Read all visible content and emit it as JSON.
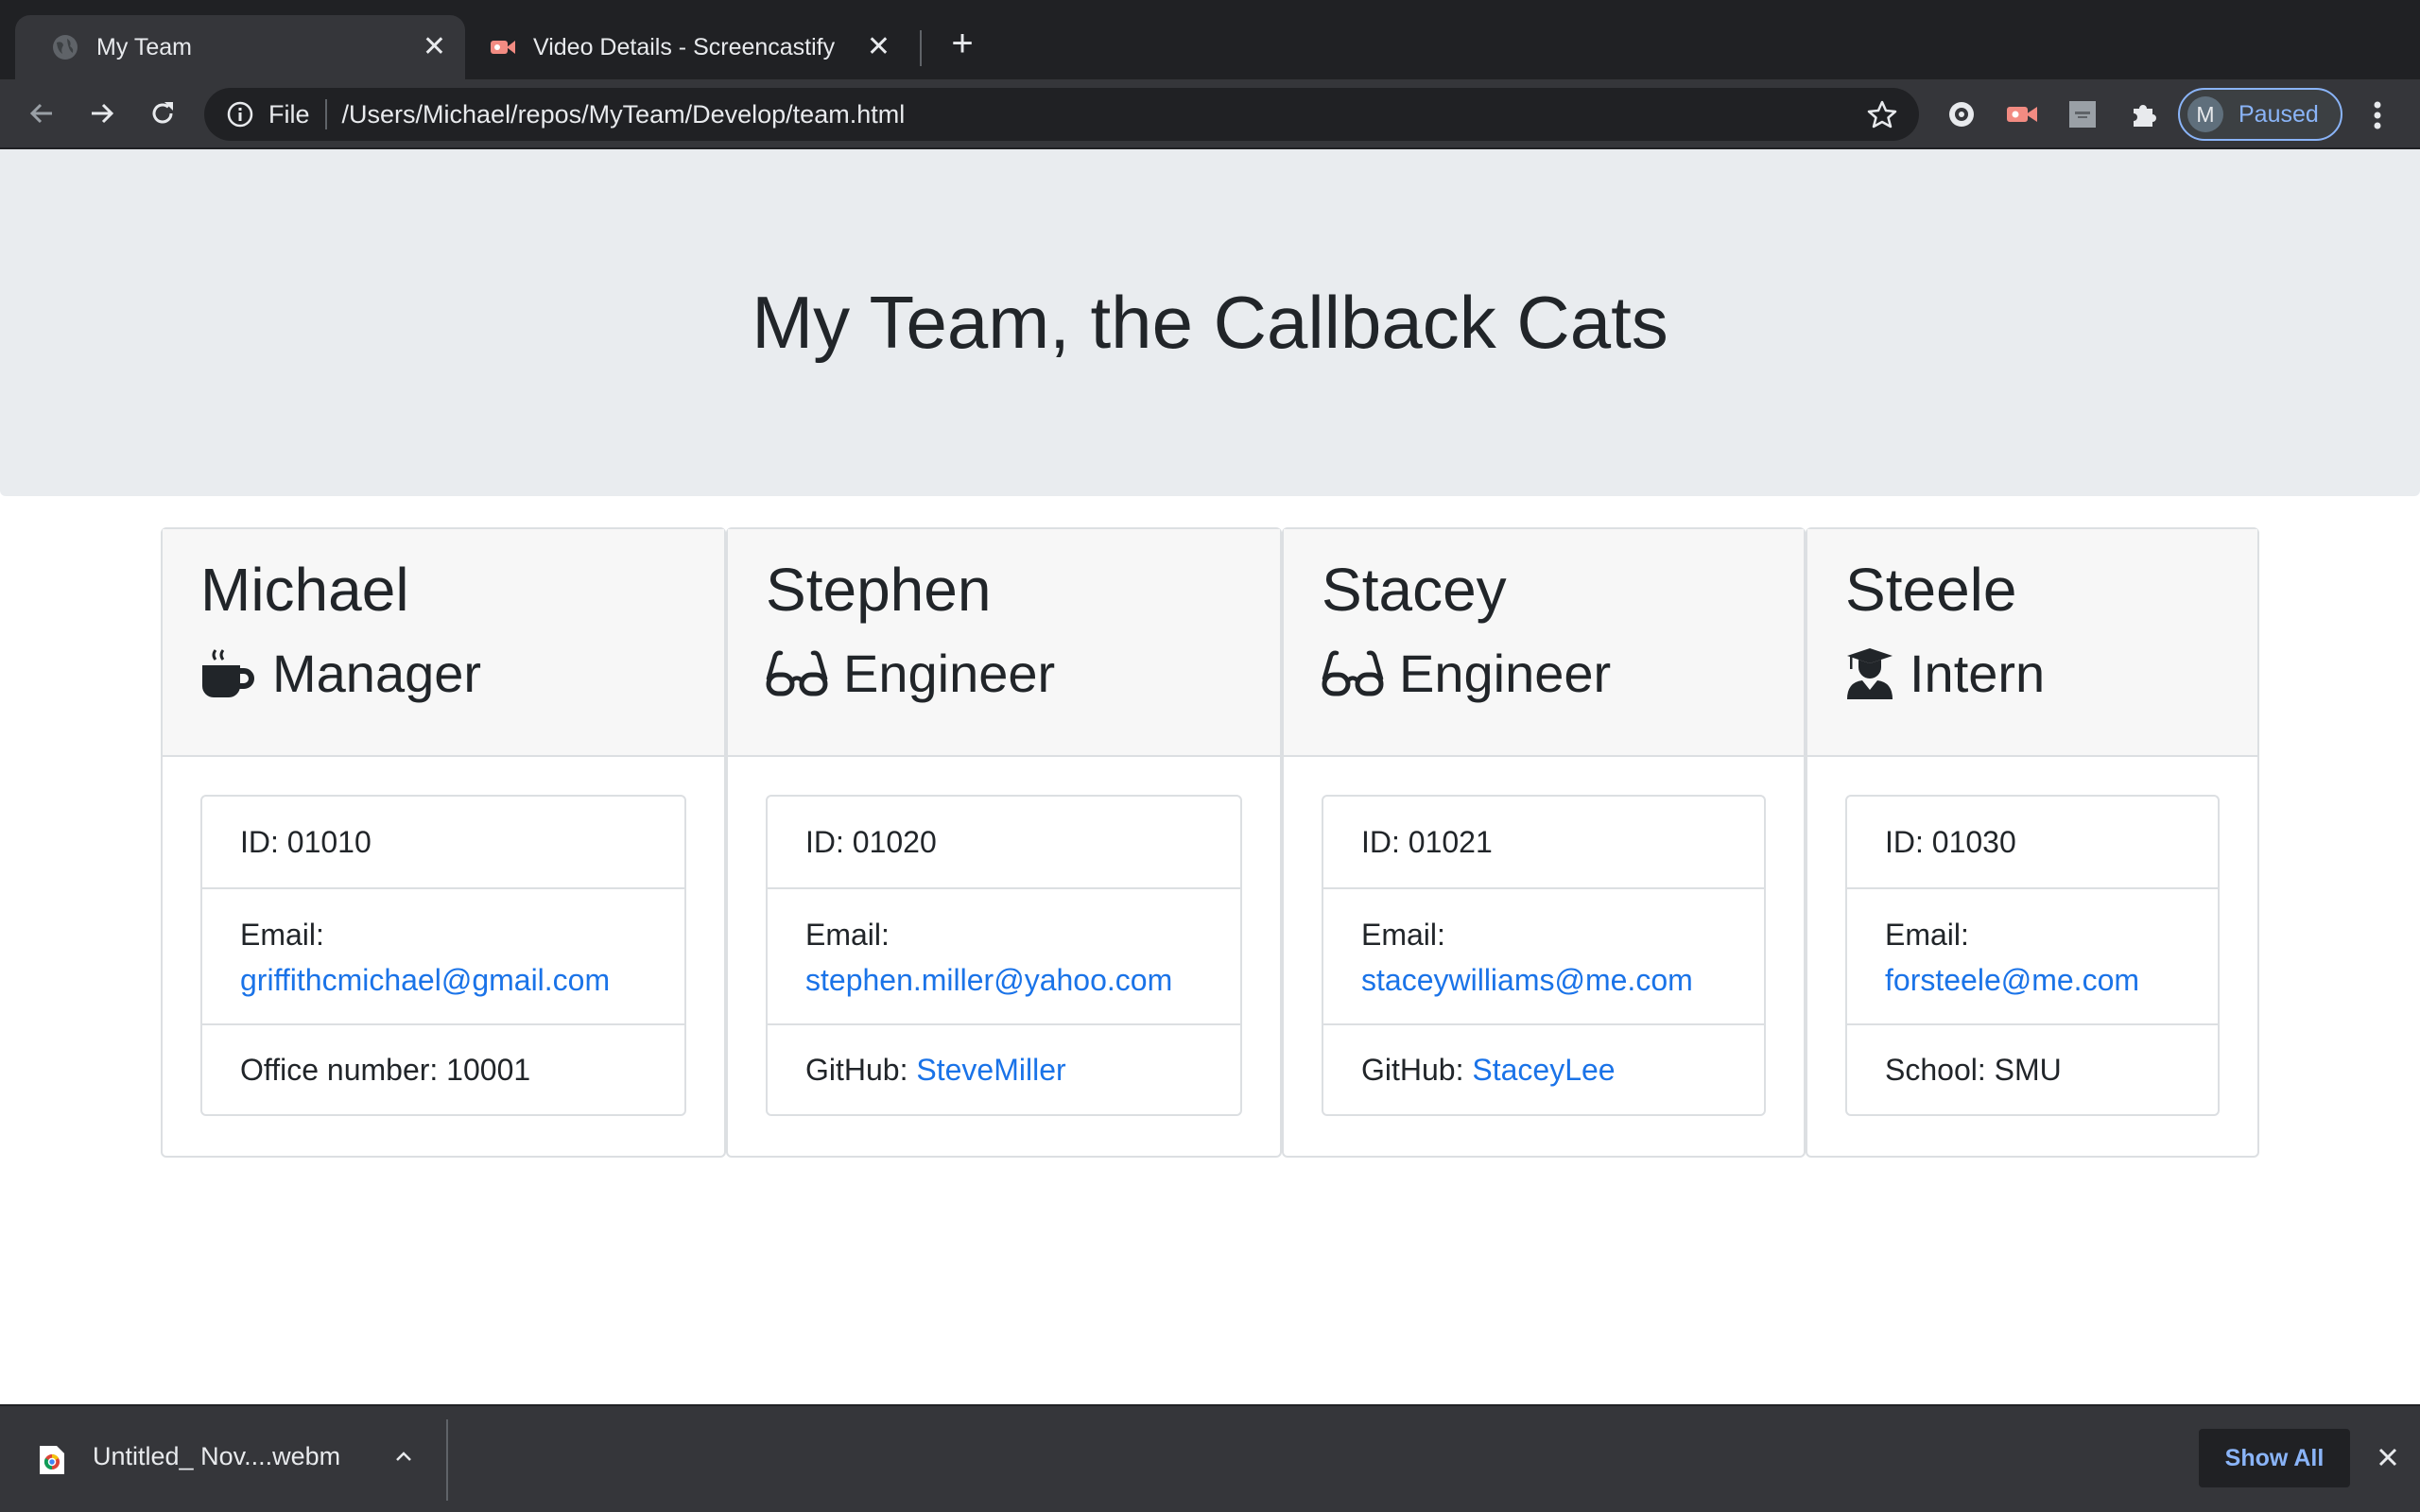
{
  "browser": {
    "tabs": [
      {
        "title": "My Team",
        "active": true
      },
      {
        "title": "Video Details - Screencastify",
        "active": false
      }
    ],
    "address": {
      "scheme": "File",
      "url": "/Users/Michael/repos/MyTeam/Develop/team.html"
    },
    "profile": {
      "initial": "M",
      "status": "Paused"
    },
    "accent_color": "#8ab4f8"
  },
  "page": {
    "title": "My Team, the Callback Cats",
    "members": [
      {
        "name": "Michael",
        "role": "Manager",
        "icon": "mug-icon",
        "id": "ID: 01010",
        "email_label": "Email:",
        "email": "griffithcmichael@gmail.com",
        "extra_label": "Office number: 10001",
        "extra_link": ""
      },
      {
        "name": "Stephen",
        "role": "Engineer",
        "icon": "glasses-icon",
        "id": "ID: 01020",
        "email_label": "Email:",
        "email": "stephen.miller@yahoo.com",
        "extra_label": "GitHub: ",
        "extra_link": "SteveMiller"
      },
      {
        "name": "Stacey",
        "role": "Engineer",
        "icon": "glasses-icon",
        "id": "ID: 01021",
        "email_label": "Email:",
        "email": "staceywilliams@me.com",
        "extra_label": "GitHub: ",
        "extra_link": "StaceyLee"
      },
      {
        "name": "Steele",
        "role": "Intern",
        "icon": "graduate-icon",
        "id": "ID: 01030",
        "email_label": "Email:",
        "email": "forsteele@me.com",
        "extra_label": "School: SMU",
        "extra_link": ""
      }
    ],
    "link_color": "#1a73e8"
  },
  "download_shelf": {
    "file_name": "Untitled_ Nov....webm",
    "show_all_label": "Show All"
  }
}
